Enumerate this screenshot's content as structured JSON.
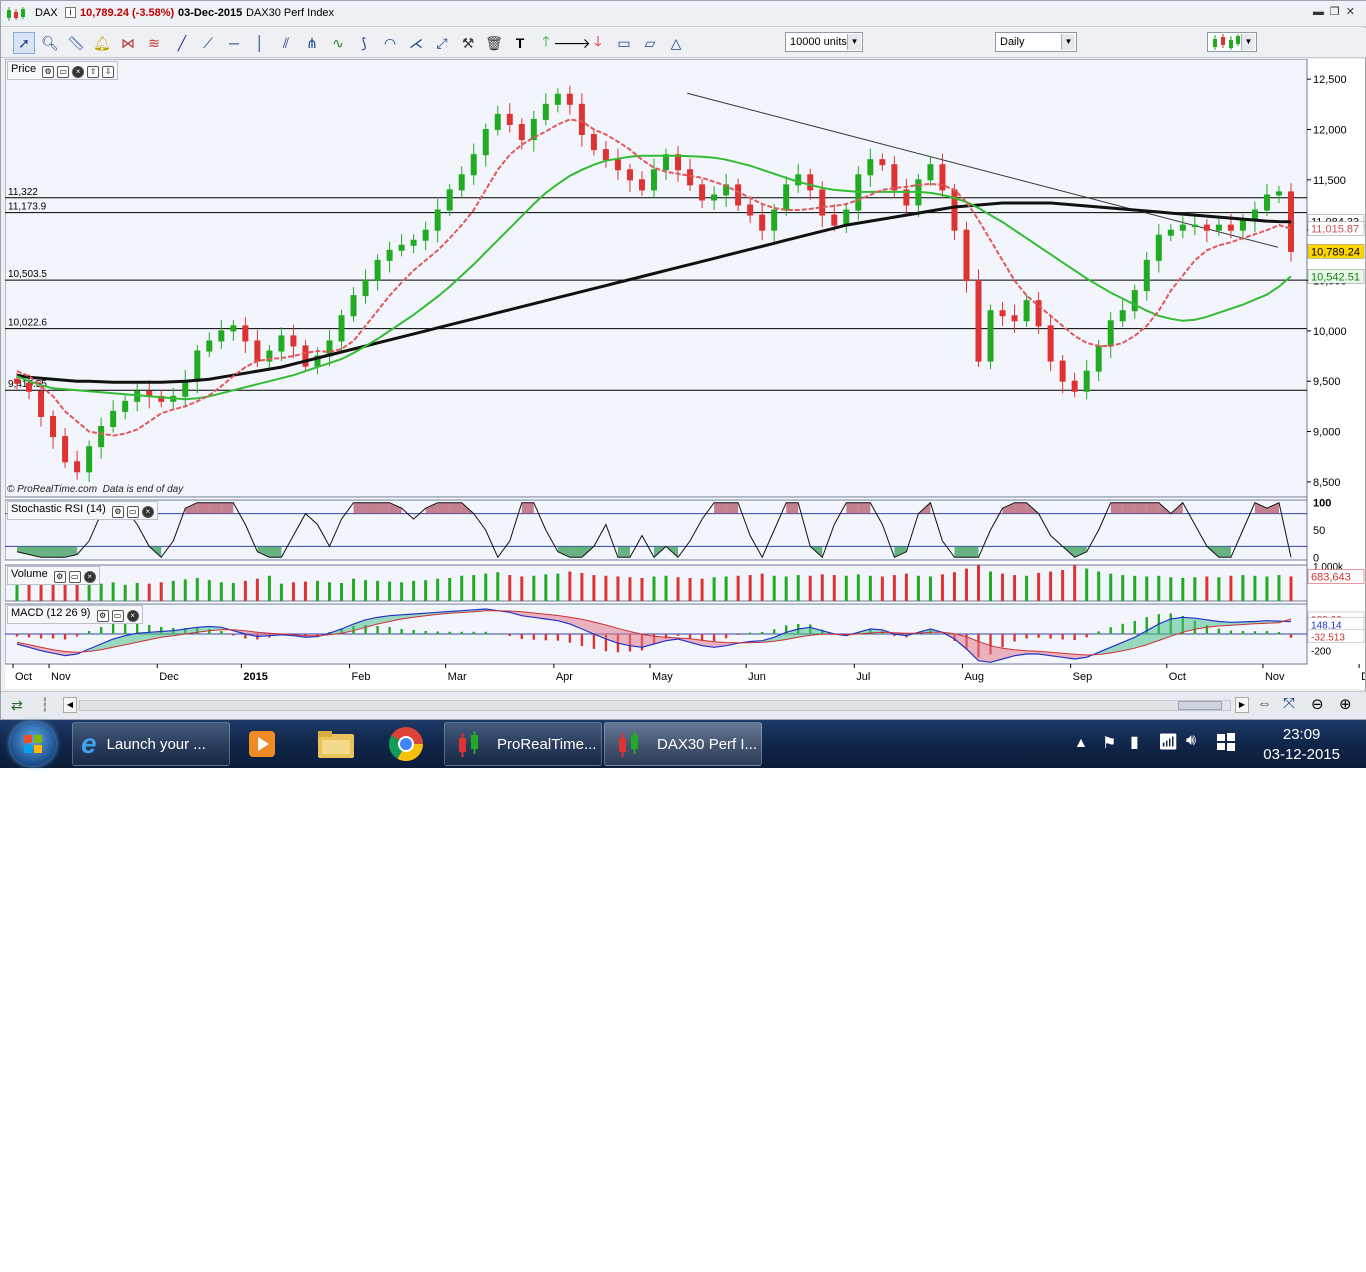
{
  "window": {
    "instrument": "DAX",
    "price_change": "10,789.24 (-3.58%)",
    "date": "03-Dec-2015",
    "index_name": "DAX30 Perf Index"
  },
  "toolbar": {
    "units": "10000 units",
    "period": "Daily"
  },
  "panels": {
    "price": "Price",
    "stoch": "Stochastic RSI (14)",
    "volume": "Volume",
    "macd": "MACD (12 26 9)"
  },
  "footer_note": "© ProRealTime.com  Data is end of day",
  "colors": {
    "up": "#22aa22",
    "down": "#dd3333",
    "ma20": "#e05a5a",
    "ma50": "#33bb33",
    "ma200": "#111111",
    "panel_bg": "#f3f5fd",
    "cur_price_bg": "#ffd700"
  },
  "chart_data": [
    {
      "type": "candlestick",
      "title": "Price",
      "y_ticks": [
        "12,500",
        "12,000",
        "11,500",
        "11,000",
        "10,500",
        "10,000",
        "9,500",
        "9,000",
        "8,500"
      ],
      "ylim": [
        8350,
        12700
      ],
      "x_ticks": [
        "Oct",
        "Nov",
        "Dec",
        "2015",
        "Feb",
        "Mar",
        "Apr",
        "May",
        "Jun",
        "Jul",
        "Aug",
        "Sep",
        "Oct",
        "Nov",
        "Dec"
      ],
      "price_labels": [
        {
          "label": "11,084.33",
          "value": 11084,
          "kind": "ma200"
        },
        {
          "label": "11,015.87",
          "value": 11016,
          "kind": "ma20"
        },
        {
          "label": "10,789.24",
          "value": 10789,
          "kind": "current"
        },
        {
          "label": "10,542.51",
          "value": 10542,
          "kind": "ma50"
        }
      ],
      "hlines": [
        {
          "label": "11,322",
          "value": 11322
        },
        {
          "label": "11,173.9",
          "value": 11174
        },
        {
          "label": "10,503.5",
          "value": 10503.5
        },
        {
          "label": "10,022.6",
          "value": 10022.6
        },
        {
          "label": "9,410.55",
          "value": 9410.55
        }
      ],
      "trendline": {
        "from": [
          160,
          12360
        ],
        "to": [
          301,
          10830
        ]
      },
      "closes": [
        9480,
        9400,
        9150,
        8950,
        8700,
        8600,
        8850,
        9050,
        9200,
        9300,
        9400,
        9350,
        9300,
        9350,
        9500,
        9800,
        9900,
        10000,
        10050,
        9900,
        9700,
        9800,
        9950,
        9850,
        9650,
        9750,
        9900,
        10150,
        10350,
        10500,
        10700,
        10800,
        10850,
        10900,
        11000,
        11200,
        11400,
        11550,
        11750,
        12000,
        12150,
        12050,
        11900,
        12100,
        12250,
        12350,
        12250,
        11950,
        11800,
        11700,
        11600,
        11500,
        11400,
        11600,
        11750,
        11600,
        11450,
        11300,
        11350,
        11450,
        11250,
        11150,
        11000,
        11200,
        11450,
        11550,
        11400,
        11150,
        11050,
        11200,
        11550,
        11700,
        11650,
        11400,
        11250,
        11500,
        11650,
        11400,
        11000,
        10500,
        9700,
        10200,
        10150,
        10100,
        10300,
        10050,
        9700,
        9500,
        9400,
        9600,
        9850,
        10100,
        10200,
        10400,
        10700,
        10950,
        11000,
        11050,
        11050,
        11000,
        11050,
        11000,
        11100,
        11200,
        11350,
        11380,
        10789
      ],
      "ma20": [
        9600,
        9550,
        9450,
        9350,
        9200,
        9100,
        9000,
        8980,
        8960,
        8980,
        9020,
        9100,
        9180,
        9220,
        9250,
        9300,
        9360,
        9450,
        9550,
        9640,
        9700,
        9720,
        9730,
        9750,
        9780,
        9800,
        9790,
        9820,
        9900,
        10050,
        10200,
        10350,
        10480,
        10600,
        10700,
        10800,
        10920,
        11050,
        11200,
        11400,
        11600,
        11750,
        11850,
        11920,
        11980,
        12050,
        12100,
        12080,
        12000,
        11950,
        11880,
        11800,
        11700,
        11620,
        11580,
        11560,
        11540,
        11520,
        11480,
        11440,
        11380,
        11320,
        11260,
        11220,
        11200,
        11200,
        11210,
        11230,
        11240,
        11260,
        11300,
        11350,
        11400,
        11420,
        11430,
        11450,
        11460,
        11450,
        11400,
        11280,
        11100,
        10900,
        10700,
        10500,
        10350,
        10250,
        10150,
        10050,
        9950,
        9880,
        9850,
        9850,
        9880,
        9950,
        10050,
        10200,
        10400,
        10550,
        10700,
        10800,
        10850,
        10880,
        10920,
        10960,
        11000,
        11050,
        11016
      ],
      "ma50": [
        9550,
        9500,
        9460,
        9430,
        9420,
        9410,
        9400,
        9390,
        9380,
        9370,
        9360,
        9350,
        9340,
        9330,
        9320,
        9330,
        9350,
        9380,
        9410,
        9440,
        9470,
        9500,
        9530,
        9560,
        9600,
        9640,
        9680,
        9720,
        9780,
        9850,
        9920,
        10000,
        10080,
        10160,
        10250,
        10340,
        10440,
        10550,
        10660,
        10780,
        10900,
        11020,
        11140,
        11260,
        11370,
        11460,
        11540,
        11600,
        11650,
        11690,
        11710,
        11730,
        11740,
        11740,
        11740,
        11740,
        11735,
        11730,
        11720,
        11700,
        11670,
        11640,
        11600,
        11560,
        11520,
        11480,
        11450,
        11420,
        11400,
        11390,
        11380,
        11380,
        11380,
        11380,
        11380,
        11380,
        11370,
        11350,
        11320,
        11280,
        11220,
        11150,
        11080,
        11000,
        10920,
        10840,
        10760,
        10680,
        10600,
        10520,
        10450,
        10380,
        10320,
        10260,
        10200,
        10150,
        10120,
        10100,
        10110,
        10140,
        10180,
        10220,
        10260,
        10310,
        10360,
        10440,
        10542
      ],
      "ma200": [
        9560,
        9540,
        9530,
        9520,
        9510,
        9500,
        9500,
        9495,
        9490,
        9490,
        9490,
        9490,
        9490,
        9495,
        9500,
        9510,
        9520,
        9540,
        9560,
        9580,
        9600,
        9620,
        9640,
        9670,
        9700,
        9730,
        9760,
        9790,
        9820,
        9850,
        9880,
        9910,
        9940,
        9970,
        10000,
        10030,
        10060,
        10090,
        10120,
        10150,
        10180,
        10210,
        10240,
        10270,
        10300,
        10330,
        10360,
        10390,
        10420,
        10450,
        10480,
        10510,
        10540,
        10570,
        10600,
        10630,
        10660,
        10690,
        10720,
        10750,
        10780,
        10810,
        10840,
        10870,
        10900,
        10930,
        10960,
        10990,
        11020,
        11050,
        11070,
        11090,
        11110,
        11130,
        11150,
        11170,
        11190,
        11210,
        11230,
        11240,
        11250,
        11260,
        11270,
        11270,
        11270,
        11270,
        11270,
        11260,
        11250,
        11240,
        11230,
        11220,
        11210,
        11200,
        11190,
        11180,
        11170,
        11160,
        11150,
        11140,
        11130,
        11120,
        11110,
        11100,
        11090,
        11085,
        11084
      ]
    },
    {
      "type": "line",
      "title": "Stochastic RSI (14)",
      "y_ticks": [
        "100",
        "50",
        "0"
      ],
      "ylim": [
        -5,
        105
      ],
      "bands": [
        80,
        20
      ],
      "values": [
        10,
        5,
        0,
        0,
        0,
        5,
        30,
        80,
        100,
        90,
        60,
        20,
        0,
        30,
        90,
        100,
        100,
        100,
        100,
        60,
        10,
        0,
        0,
        40,
        80,
        60,
        20,
        70,
        100,
        100,
        100,
        100,
        90,
        70,
        90,
        100,
        100,
        100,
        80,
        50,
        0,
        30,
        100,
        100,
        50,
        10,
        0,
        0,
        20,
        60,
        0,
        0,
        40,
        0,
        20,
        0,
        30,
        70,
        100,
        100,
        100,
        40,
        0,
        50,
        100,
        100,
        20,
        0,
        60,
        100,
        100,
        100,
        60,
        0,
        10,
        80,
        100,
        30,
        0,
        0,
        0,
        50,
        90,
        100,
        100,
        80,
        40,
        20,
        0,
        10,
        50,
        100,
        100,
        100,
        100,
        100,
        80,
        100,
        60,
        20,
        0,
        0,
        50,
        100,
        90,
        100,
        0
      ]
    },
    {
      "type": "bar",
      "title": "Volume",
      "y_ticks": [
        "1,000k"
      ],
      "last_value": "683,643",
      "volume_k": [
        520,
        480,
        560,
        600,
        640,
        720,
        500,
        480,
        520,
        450,
        500,
        480,
        520,
        560,
        600,
        640,
        580,
        520,
        500,
        560,
        620,
        700,
        480,
        520,
        540,
        560,
        520,
        500,
        620,
        580,
        560,
        540,
        520,
        560,
        580,
        620,
        640,
        700,
        720,
        760,
        800,
        720,
        680,
        700,
        740,
        760,
        820,
        780,
        720,
        700,
        680,
        660,
        640,
        680,
        700,
        660,
        640,
        620,
        660,
        680,
        700,
        720,
        760,
        700,
        680,
        720,
        700,
        740,
        720,
        700,
        740,
        700,
        680,
        720,
        760,
        700,
        680,
        740,
        800,
        900,
        1000,
        820,
        760,
        720,
        700,
        780,
        820,
        860,
        1000,
        900,
        820,
        760,
        720,
        700,
        680,
        700,
        660,
        640,
        660,
        680,
        660,
        700,
        720,
        700,
        680,
        720,
        684
      ]
    },
    {
      "type": "line",
      "title": "MACD (12 26 9)",
      "y_ticks": [
        "180.66",
        "148.14",
        "-32.513",
        "-200"
      ],
      "ylim": [
        -360,
        360
      ],
      "macd": [
        -120,
        -160,
        -200,
        -230,
        -260,
        -240,
        -180,
        -120,
        -60,
        -20,
        10,
        20,
        30,
        40,
        60,
        80,
        90,
        80,
        40,
        0,
        -30,
        -20,
        -10,
        -20,
        -40,
        -30,
        10,
        60,
        120,
        170,
        200,
        220,
        230,
        240,
        250,
        260,
        270,
        280,
        290,
        300,
        280,
        260,
        220,
        200,
        180,
        160,
        120,
        60,
        0,
        -60,
        -110,
        -140,
        -160,
        -120,
        -80,
        -60,
        -100,
        -140,
        -160,
        -140,
        -110,
        -90,
        -80,
        -40,
        20,
        60,
        80,
        40,
        0,
        -20,
        20,
        60,
        50,
        0,
        -20,
        20,
        60,
        20,
        -60,
        -180,
        -320,
        -340,
        -300,
        -260,
        -240,
        -240,
        -260,
        -280,
        -300,
        -280,
        -220,
        -160,
        -100,
        -40,
        40,
        120,
        180,
        200,
        190,
        170,
        150,
        140,
        145,
        150,
        160,
        155,
        148
      ],
      "signal": [
        -100,
        -130,
        -160,
        -190,
        -210,
        -220,
        -210,
        -190,
        -160,
        -130,
        -100,
        -70,
        -40,
        -20,
        0,
        20,
        40,
        50,
        50,
        40,
        20,
        10,
        0,
        -10,
        -20,
        -20,
        -10,
        10,
        40,
        80,
        120,
        150,
        180,
        200,
        220,
        235,
        248,
        258,
        268,
        278,
        280,
        276,
        266,
        252,
        238,
        222,
        202,
        176,
        144,
        108,
        68,
        30,
        -2,
        -26,
        -40,
        -48,
        -58,
        -74,
        -92,
        -102,
        -106,
        -104,
        -100,
        -88,
        -66,
        -40,
        -16,
        -4,
        -4,
        -8,
        0,
        12,
        20,
        16,
        8,
        10,
        20,
        20,
        4,
        -32,
        -90,
        -140,
        -172,
        -190,
        -200,
        -208,
        -218,
        -230,
        -244,
        -252,
        -246,
        -228,
        -202,
        -170,
        -128,
        -78,
        -26,
        20,
        56,
        80,
        96,
        106,
        114,
        122,
        130,
        136,
        181
      ]
    }
  ],
  "statusbar": {},
  "taskbar": {
    "ie": "Launch your ...",
    "prt": "ProRealTime...",
    "dax": "DAX30 Perf I...",
    "time": "23:09",
    "date": "03-12-2015"
  }
}
